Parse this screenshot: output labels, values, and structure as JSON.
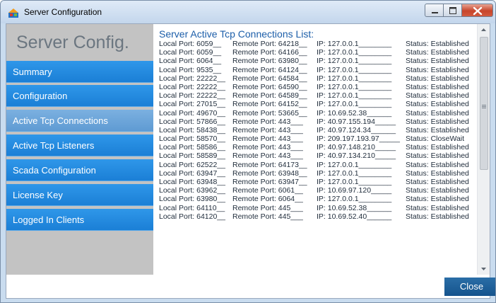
{
  "window": {
    "title": "Server Configuration",
    "controls": [
      "minimize",
      "maximize",
      "close"
    ]
  },
  "sidebar": {
    "brand": "Server Config.",
    "items": [
      {
        "label": "Summary"
      },
      {
        "label": "Configuration"
      },
      {
        "label": "Active Tcp Connections"
      },
      {
        "label": "Active Tcp Listeners"
      },
      {
        "label": "Scada Configuration"
      },
      {
        "label": "License Key"
      },
      {
        "label": "Logged In Clients"
      }
    ],
    "active_index": 2
  },
  "content": {
    "title": "Server Active Tcp Connections List:",
    "rows": [
      {
        "local": "Local Port: 6059__",
        "remote": "Remote Port: 64218__",
        "ip": "IP: 127.0.0.1________",
        "status": "Status: Established"
      },
      {
        "local": "Local Port: 6059__",
        "remote": "Remote Port: 64166__",
        "ip": "IP: 127.0.0.1________",
        "status": "Status: Established"
      },
      {
        "local": "Local Port: 6064__",
        "remote": "Remote Port: 63980__",
        "ip": "IP: 127.0.0.1________",
        "status": "Status: Established"
      },
      {
        "local": "Local Port: 9535__",
        "remote": "Remote Port: 64124__",
        "ip": "IP: 127.0.0.1________",
        "status": "Status: Established"
      },
      {
        "local": "Local Port: 22222__",
        "remote": "Remote Port: 64584__",
        "ip": "IP: 127.0.0.1________",
        "status": "Status: Established"
      },
      {
        "local": "Local Port: 22222__",
        "remote": "Remote Port: 64590__",
        "ip": "IP: 127.0.0.1________",
        "status": "Status: Established"
      },
      {
        "local": "Local Port: 22222__",
        "remote": "Remote Port: 64589__",
        "ip": "IP: 127.0.0.1________",
        "status": "Status: Established"
      },
      {
        "local": "Local Port: 27015__",
        "remote": "Remote Port: 64152__",
        "ip": "IP: 127.0.0.1________",
        "status": "Status: Established"
      },
      {
        "local": "Local Port: 49670__",
        "remote": "Remote Port: 53665__",
        "ip": "IP: 10.69.52.38______",
        "status": "Status: Established"
      },
      {
        "local": "Local Port: 57866__",
        "remote": "Remote Port: 443___",
        "ip": "IP: 40.97.155.194_____",
        "status": "Status: Established"
      },
      {
        "local": "Local Port: 58438__",
        "remote": "Remote Port: 443___",
        "ip": "IP: 40.97.124.34______",
        "status": "Status: Established"
      },
      {
        "local": "Local Port: 58570__",
        "remote": "Remote Port: 443___",
        "ip": "IP: 209.197.193.97_____",
        "status": "Status: CloseWait"
      },
      {
        "local": "Local Port: 58586__",
        "remote": "Remote Port: 443___",
        "ip": "IP: 40.97.148.210_____",
        "status": "Status: Established"
      },
      {
        "local": "Local Port: 58589__",
        "remote": "Remote Port: 443___",
        "ip": "IP: 40.97.134.210_____",
        "status": "Status: Established"
      },
      {
        "local": "Local Port: 62522__",
        "remote": "Remote Port: 64173__",
        "ip": "IP: 127.0.0.1________",
        "status": "Status: Established"
      },
      {
        "local": "Local Port: 63947__",
        "remote": "Remote Port: 63948__",
        "ip": "IP: 127.0.0.1________",
        "status": "Status: Established"
      },
      {
        "local": "Local Port: 63948__",
        "remote": "Remote Port: 63947__",
        "ip": "IP: 127.0.0.1________",
        "status": "Status: Established"
      },
      {
        "local": "Local Port: 63962__",
        "remote": "Remote Port: 6061__",
        "ip": "IP: 10.69.97.120_____",
        "status": "Status: Established"
      },
      {
        "local": "Local Port: 63980__",
        "remote": "Remote Port: 6064__",
        "ip": "IP: 127.0.0.1________",
        "status": "Status: Established"
      },
      {
        "local": "Local Port: 64110__",
        "remote": "Remote Port: 445___",
        "ip": "IP: 10.69.52.38______",
        "status": "Status: Established"
      },
      {
        "local": "Local Port: 64120__",
        "remote": "Remote Port: 445___",
        "ip": "IP: 10.69.52.40______",
        "status": "Status: Established"
      }
    ]
  },
  "footer": {
    "close_label": "Close"
  },
  "colors": {
    "nav_blue": "#1b7fd6",
    "nav_active": "#5f9bd3",
    "title_blue": "#1c5ea9",
    "close_button": "#15538d"
  }
}
